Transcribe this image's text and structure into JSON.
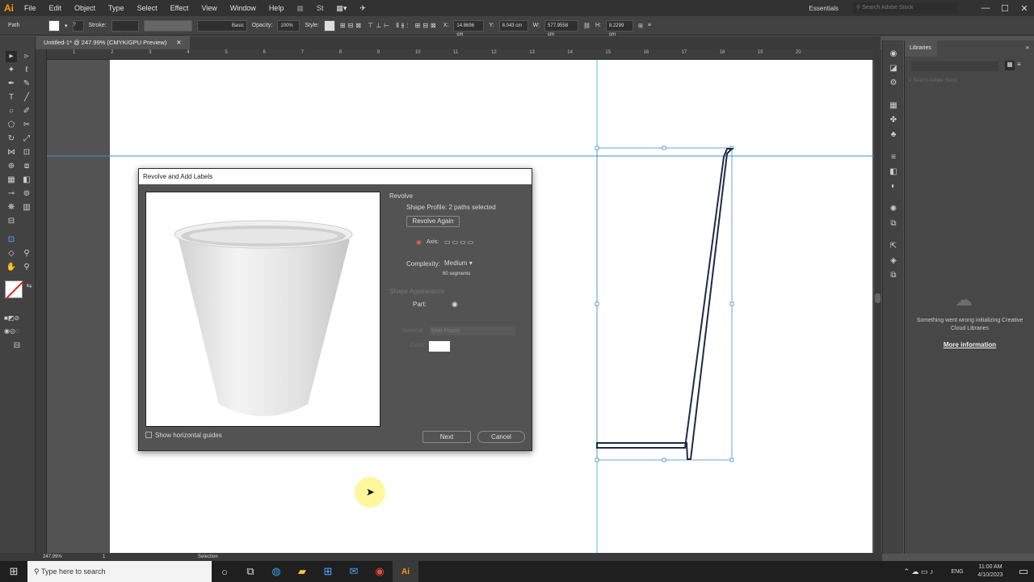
{
  "app": {
    "logo": "Ai",
    "workspace": "Essentials",
    "search_placeholder": "Search Adobe Stock"
  },
  "menu": [
    "File",
    "Edit",
    "Object",
    "Type",
    "Select",
    "Effect",
    "View",
    "Window",
    "Help"
  ],
  "control": {
    "object": "Path",
    "stroke_label": "Stroke:",
    "brush": "Basic",
    "opacity_label": "Opacity:",
    "opacity": "100%",
    "style_label": "Style:",
    "x_label": "X:",
    "x": "14.8696 cm",
    "y_label": "Y:",
    "y": "8.043 cm",
    "w_label": "W:",
    "w": "577.9558 cm",
    "h_label": "H:",
    "h": "8.2299 cm"
  },
  "document": {
    "tab": "Untitled-1* @ 247.99% (CMYK/GPU Preview)"
  },
  "ruler": [
    "1",
    "2",
    "3",
    "4",
    "5",
    "6",
    "7",
    "8",
    "9",
    "10",
    "11",
    "12",
    "13",
    "14",
    "15",
    "16",
    "17",
    "18",
    "19",
    "20"
  ],
  "status": {
    "zoom": "247.99%",
    "artboard": "1",
    "tool": "Selection"
  },
  "dialog": {
    "title": "Revolve and Add Labels",
    "section": "Revolve",
    "shape_profile": "Shape Profile: 2 paths selected",
    "revolve_again": "Revolve Again",
    "axis_label": "Axis:",
    "complexity_label": "Complexity:",
    "complexity": "Medium",
    "segments": "60 segments",
    "shape_appearance": "Shape Appearance",
    "part_label": "Part:",
    "material_label": "Material:",
    "material": "Matt Plastic",
    "color_label": "Color:",
    "show_guides": "Show horizontal guides",
    "next": "Next",
    "cancel": "Cancel"
  },
  "libraries": {
    "title": "Libraries",
    "search_placeholder": "Search Adobe Stock",
    "error": "Something went wrong initializing Creative Cloud Libraries",
    "more_info": "More information"
  },
  "taskbar": {
    "search": "Type here to search",
    "lang": "ENG",
    "time": "11:00 AM",
    "date": "4/10/2023"
  },
  "colors": {
    "accent": "#ff9a00",
    "guide": "#5fc4b5",
    "path": "#1d2b48",
    "bbox": "#4a8fd0"
  }
}
